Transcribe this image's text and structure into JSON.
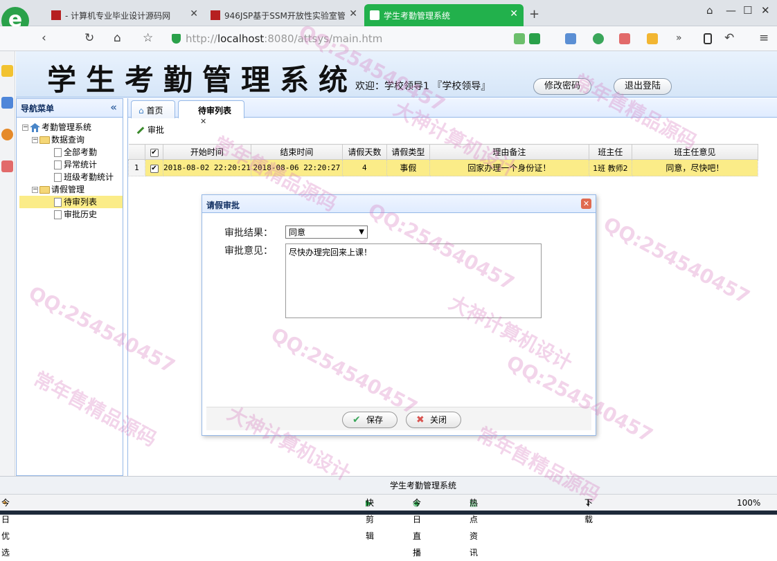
{
  "browser": {
    "tabs": [
      {
        "label": "- 计算机专业毕业设计源码网"
      },
      {
        "label": "946JSP基于SSM开放性实验室管"
      },
      {
        "label": "学生考勤管理系统"
      }
    ],
    "url_prefix": "http://",
    "url_host": "localhost",
    "url_rest": ":8080/attsys/main.htm"
  },
  "header": {
    "title": "学生考勤管理系统",
    "welcome": "欢迎：学校领导1 『学校领导』",
    "change_password": "修改密码",
    "logout": "退出登陆"
  },
  "nav": {
    "title": "导航菜单",
    "root": "考勤管理系统",
    "group1": "数据查询",
    "g1_items": [
      "全部考勤",
      "异常统计",
      "班级考勤统计"
    ],
    "group2": "请假管理",
    "g2_items": [
      "待审列表",
      "审批历史"
    ]
  },
  "main": {
    "tabs": [
      "首页",
      "待审列表"
    ],
    "toolbar_approve": "审批",
    "columns": [
      "开始时间",
      "结束时间",
      "请假天数",
      "请假类型",
      "理由备注",
      "班主任",
      "班主任意见"
    ],
    "rows": [
      {
        "num": "1",
        "start": "2018-08-02 22:20:21",
        "end": "2018-08-06 22:20:27",
        "days": "4",
        "type": "事假",
        "reason": "回家办理一个身份证！",
        "teacher": "1班 教师2",
        "opinion": "同意，尽快吧！"
      }
    ]
  },
  "dialog": {
    "title": "请假审批",
    "result_label": "审批结果：",
    "result_value": "同意",
    "opinion_label": "审批意见：",
    "opinion_value": "尽快办理完回来上课！",
    "save": "保存",
    "close": "关闭"
  },
  "footer": {
    "text": "学生考勤管理系统"
  },
  "browser_status": {
    "left": "今日优选",
    "items": [
      "快剪辑",
      "今日直播",
      "热点资讯",
      "下载"
    ],
    "zoom": "100%"
  },
  "watermark": [
    "QQ:254540457",
    "常年售精品源码",
    "大神计算机设计"
  ],
  "colors": {
    "accent": "#22b14c",
    "panel_border": "#95b8e7",
    "highlight": "#fbec88"
  }
}
